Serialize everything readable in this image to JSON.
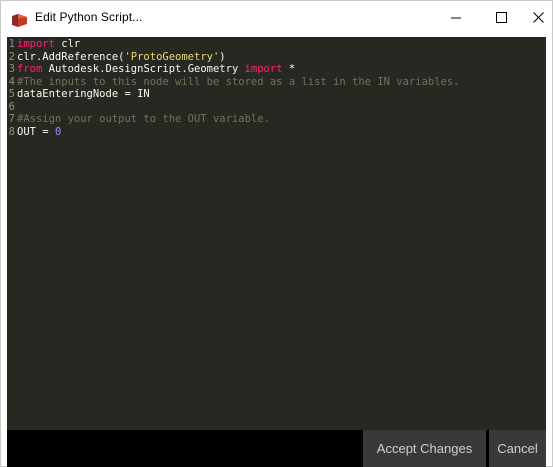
{
  "window": {
    "title": "Edit Python Script...",
    "app_icon": "dynamo-app-icon",
    "controls": {
      "minimize_icon": "minimize-icon",
      "maximize_icon": "maximize-icon",
      "close_icon": "close-icon"
    }
  },
  "editor": {
    "lines": [
      {
        "number": "1",
        "tokens": [
          {
            "type": "kw",
            "text": "import"
          },
          {
            "type": "id",
            "text": " clr"
          }
        ]
      },
      {
        "number": "2",
        "tokens": [
          {
            "type": "id",
            "text": "clr.AddReference("
          },
          {
            "type": "str",
            "text": "'ProtoGeometry'"
          },
          {
            "type": "id",
            "text": ")"
          }
        ]
      },
      {
        "number": "3",
        "tokens": [
          {
            "type": "kw",
            "text": "from"
          },
          {
            "type": "id",
            "text": " Autodesk.DesignScript.Geometry "
          },
          {
            "type": "kw",
            "text": "import"
          },
          {
            "type": "id",
            "text": " *"
          }
        ]
      },
      {
        "number": "4",
        "tokens": [
          {
            "type": "cm",
            "text": "#The inputs to this node will be stored as a list in the IN variables."
          }
        ]
      },
      {
        "number": "5",
        "tokens": [
          {
            "type": "id",
            "text": "dataEnteringNode = IN"
          }
        ]
      },
      {
        "number": "6",
        "tokens": []
      },
      {
        "number": "7",
        "tokens": [
          {
            "type": "cm",
            "text": "#Assign your output to the OUT variable."
          }
        ]
      },
      {
        "number": "8",
        "tokens": [
          {
            "type": "id",
            "text": "OUT = "
          },
          {
            "type": "num",
            "text": "0"
          }
        ]
      }
    ]
  },
  "footer": {
    "accept_label": "Accept Changes",
    "cancel_label": "Cancel"
  },
  "colors": {
    "editor_background": "#272822",
    "keyword": "#f92672",
    "string": "#e6db74",
    "number": "#ae81ff",
    "comment": "#75715e",
    "identifier": "#f8f8f2",
    "line_number": "#90908a",
    "footer_background": "#000000",
    "footer_button": "#393939"
  }
}
